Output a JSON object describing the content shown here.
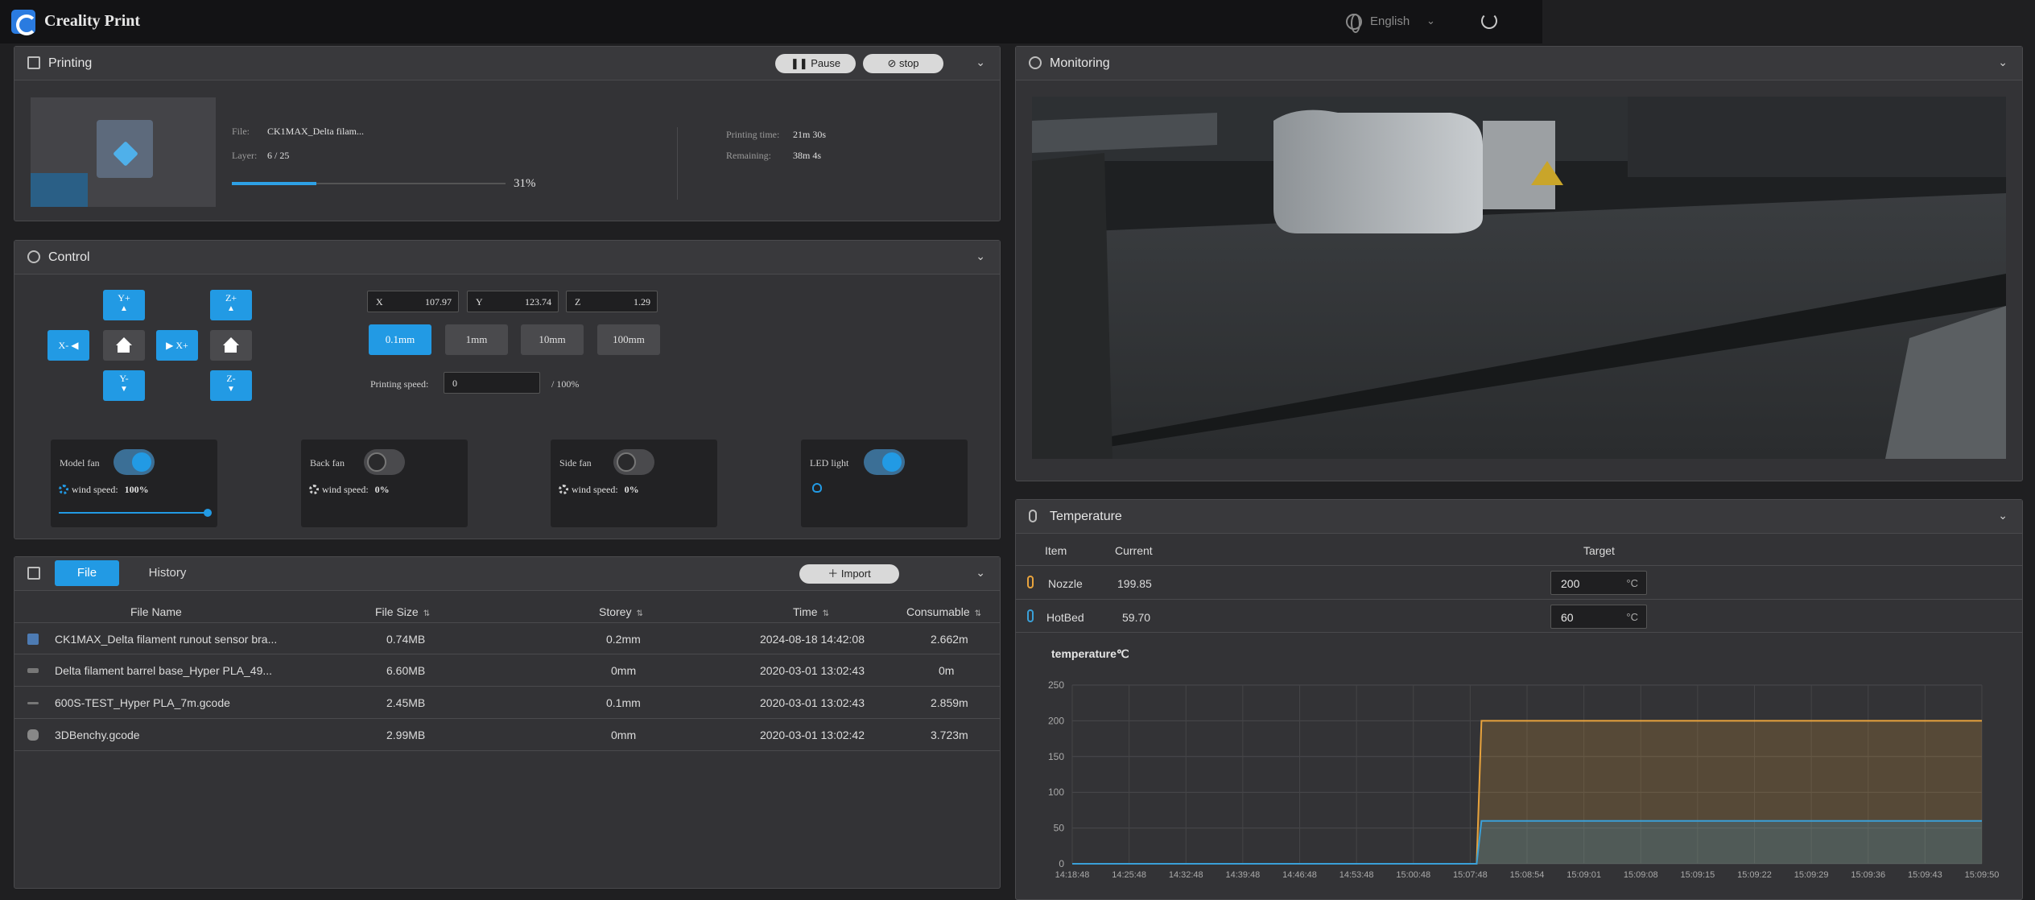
{
  "app": {
    "name": "Creality Print",
    "language": "English"
  },
  "printing": {
    "title": "Printing",
    "pause_label": "Pause",
    "stop_label": "stop",
    "file_label": "File:",
    "file_value": "CK1MAX_Delta filam...",
    "layer_label": "Layer:",
    "layer_value": "6 / 25",
    "progress": 31,
    "progress_text": "31%",
    "time_label": "Printing time:",
    "time_value": "21m 30s",
    "remaining_label": "Remaining:",
    "remaining_value": "38m 4s"
  },
  "control": {
    "title": "Control",
    "jog": {
      "yplus": "Y+",
      "yminus": "Y-",
      "xplus": "X+",
      "xminus": "X-",
      "zplus": "Z+",
      "zminus": "Z-"
    },
    "coords": [
      {
        "axis": "X",
        "value": "107.97"
      },
      {
        "axis": "Y",
        "value": "123.74"
      },
      {
        "axis": "Z",
        "value": "1.29"
      }
    ],
    "steps": [
      "0.1mm",
      "1mm",
      "10mm",
      "100mm"
    ],
    "active_step": "0.1mm",
    "speed_label": "Printing speed:",
    "speed_value": "0",
    "speed_suffix": "/ 100%",
    "fans": [
      {
        "name": "Model fan",
        "on": true,
        "wind_label": "wind speed:",
        "wind_value": "100%",
        "level": 1.0
      },
      {
        "name": "Back fan",
        "on": false,
        "wind_label": "wind speed:",
        "wind_value": "0%"
      },
      {
        "name": "Side fan",
        "on": false,
        "wind_label": "wind speed:",
        "wind_value": "0%"
      }
    ],
    "led": {
      "name": "LED light",
      "on": true
    }
  },
  "files": {
    "tabs": [
      "File",
      "History"
    ],
    "active_tab": "File",
    "import_label": "Import",
    "columns": {
      "name": "File Name",
      "size": "File Size",
      "storey": "Storey",
      "time": "Time",
      "consumable": "Consumable"
    },
    "rows": [
      {
        "name": "CK1MAX_Delta filament runout sensor bra...",
        "size": "0.74MB",
        "storey": "0.2mm",
        "time": "2024-08-18 14:42:08",
        "consumable": "2.662m"
      },
      {
        "name": "Delta filament barrel base_Hyper PLA_49...",
        "size": "6.60MB",
        "storey": "0mm",
        "time": "2020-03-01 13:02:43",
        "consumable": "0m"
      },
      {
        "name": "600S-TEST_Hyper PLA_7m.gcode",
        "size": "2.45MB",
        "storey": "0.1mm",
        "time": "2020-03-01 13:02:43",
        "consumable": "2.859m"
      },
      {
        "name": "3DBenchy.gcode",
        "size": "2.99MB",
        "storey": "0mm",
        "time": "2020-03-01 13:02:42",
        "consumable": "3.723m"
      }
    ]
  },
  "monitoring": {
    "title": "Monitoring"
  },
  "temperature": {
    "title": "Temperature",
    "columns": {
      "item": "Item",
      "current": "Current",
      "target": "Target"
    },
    "rows": [
      {
        "item": "Nozzle",
        "current": "199.85",
        "target": "200",
        "unit": "°C",
        "color": "#e8a33d"
      },
      {
        "item": "HotBed",
        "current": "59.70",
        "target": "60",
        "unit": "°C",
        "color": "#3aa0d8"
      }
    ]
  },
  "chart_data": {
    "type": "line",
    "title": "temperature℃",
    "ylim": [
      0,
      250
    ],
    "yticks": [
      0,
      50,
      100,
      150,
      200,
      250
    ],
    "x": [
      "14:18:48",
      "14:25:48",
      "14:32:48",
      "14:39:48",
      "14:46:48",
      "14:53:48",
      "15:00:48",
      "15:07:48",
      "15:08:54",
      "15:09:01",
      "15:09:08",
      "15:09:15",
      "15:09:22",
      "15:09:29",
      "15:09:36",
      "15:09:43",
      "15:09:50"
    ],
    "series": [
      {
        "name": "Nozzle",
        "color": "#e8a33d",
        "values": [
          0,
          0,
          0,
          0,
          0,
          0,
          0,
          0,
          200,
          200,
          200,
          200,
          200,
          200,
          200,
          200,
          200
        ]
      },
      {
        "name": "HotBed",
        "color": "#3aa0d8",
        "values": [
          0,
          0,
          0,
          0,
          0,
          0,
          0,
          0,
          60,
          60,
          60,
          60,
          60,
          60,
          60,
          60,
          60
        ]
      }
    ]
  }
}
